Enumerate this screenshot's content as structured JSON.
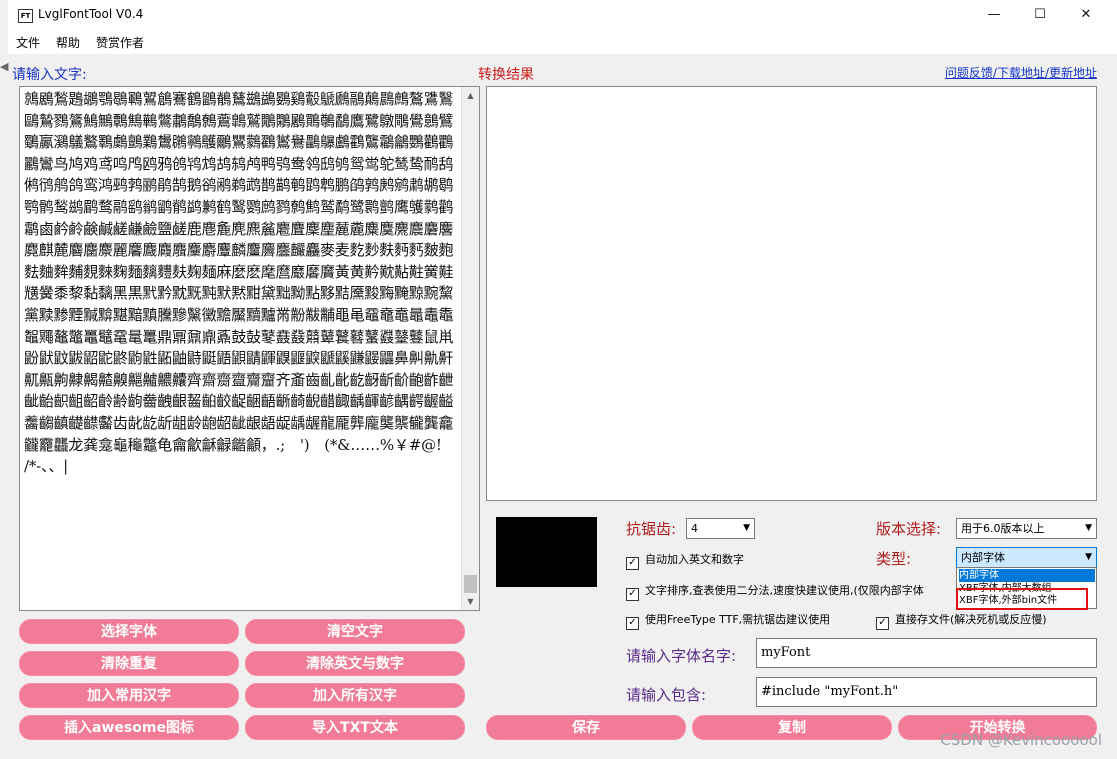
{
  "window": {
    "title": "LvglFontTool V0.4",
    "icon_text": "FT"
  },
  "menu": [
    "文件",
    "帮助",
    "赞赏作者"
  ],
  "labels": {
    "input_text": "请输入文字:",
    "result": "转换结果",
    "link": "问题反馈/下载地址/更新地址"
  },
  "input_text": "鶁鶋鶖鶗鶘鶚鶡鶤鶦鶬鶱鶴鶹鶺鶿鷀鷁鷃鷄鷇鷈鷉鷊鷏鷐鷓鷔鷕鷖鷗鷙鷚鷟鷠鷡鷣鷦鷨鷩鷫鷮鷯鷰鷱鷲鷳鷴鷵鷶鷷鷸鷹鷺鷻鷼鷽鷾鷿鸀鸁鸂鸃鸄鸅鸆鸇鸈鸉鸊鸋鸌鸍鸎鸏鸐鸑鸒鸓鸔鸕鸖鸗鸘鸙鸚鸛鸜鸝鸞鸟鸠鸡鸢鸣鸤鸥鸦鸧鸨鸩鸪鸫鸬鸭鸮鸯鸰鸱鸲鸳鸴鸵鸶鸷鸸鸹鸺鸻鸼鸽鸾鸿鹀鹁鹂鹃鹄鹅鹆鹇鹈鹉鹊鹋鹌鹍鹎鹏鹐鹑鹒鹓鹔鹕鹖鹗鹘鹙鹚鹛鹜鹝鹞鹟鹠鹡鹢鹣鹤鹥鹦鹧鹨鹩鹪鹫鹬鹭鹮鹯鹰鹱鹲鹳鹴鹵鹶鹷鹸鹹鹺鹻鹼鹽鹾鹿麀麁麂麃麄麅麆麇麈麉麊麋麌麍麎麏麐麑麒麓麔麕麖麗麘麙麚麛麜麝麞麟麠麡麢麣麤麥麦麧麨麩麪麫麬麭麮麯麰麱麲麳麴麵麶麷麸麹麺麻麼麽麾麿黀黁黂黃黄黅黆黇黈黉黊黋黌黍黎黏黐黑黒黓黔黕黖黗默黙黚黛黜黝點黟黠黡黢黣黤黥黦黧黨黩黪黫黬黭黮黯黰黱黲黳黴黵黶黷黸黹黺黻黼黽黾黿鼀鼁鼂鼃鼄鼅鼆鼇鼈鼉鼊鼋鼌鼍鼎鼏鼐鼑鼒鼓鼔鼕鼖鼗鼘鼙鼚鼛鼜鼝鼞鼟鼠鼡鼢鼣鼤鼥鼦鼧鼨鼩鼪鼫鼬鼭鼮鼯鼰鼱鼲鼳鼴鼵鼶鼷鼸鼹鼺鼻鼼鼽鼾鼿齀齁齂齃齄齅齆齇齈齉齊齋齌齍齎齏齐齑齒齓齔齕齖齗齘齙齚齛齜齝齞齟齠齡齢齣齤齥齦齧齨齩齪齫齬齭齮齯齰齱齲齳齴齵齶齷齸齹齺齻齼齽齾齿龀龁龂龃龄龅龆龇龈龉龊龋龌龍龎龏龐龑龒龓龔龕龖龗龘龙龚龛龜龝龞龟龠龡龢龣龤龥，.;　')　(*&……%￥#@!　/*-、、|",
  "controls": {
    "antialias_label": "抗锯齿:",
    "antialias_value": "4",
    "version_label": "版本选择:",
    "version_value": "用于6.0版本以上",
    "type_label": "类型:",
    "type_value": "内部字体",
    "type_options": [
      "内部字体",
      "XBF字体,内部大数组",
      "XBF字体,外部bin文件"
    ],
    "check_auto_add": "自动加入英文和数字",
    "check_sort": "文字排序,查表使用二分法,速度快建议使用,(仅限内部字体",
    "check_freetype": "使用FreeType TTF,需抗锯齿建议使用",
    "check_direct_save": "直接存文件(解决死机或反应慢)",
    "font_name_label": "请输入字体名字:",
    "font_name_value": "myFont",
    "include_label": "请输入包含:",
    "include_value": "#include \"myFont.h\""
  },
  "buttons": {
    "select_font": "选择字体",
    "clear_text": "清空文字",
    "remove_dup": "清除重复",
    "remove_en_num": "清除英文与数字",
    "add_common": "加入常用汉字",
    "add_all": "加入所有汉字",
    "insert_awesome": "插入awesome图标",
    "import_txt": "导入TXT文本",
    "save": "保存",
    "copy": "复制",
    "start": "开始转换"
  },
  "watermark": "CSDN @Kevincoooool",
  "colors": {
    "button_pink": "#f27c97",
    "label_red": "#b01c1c",
    "label_blue": "#1a33c0",
    "highlight_red": "#e01010"
  }
}
